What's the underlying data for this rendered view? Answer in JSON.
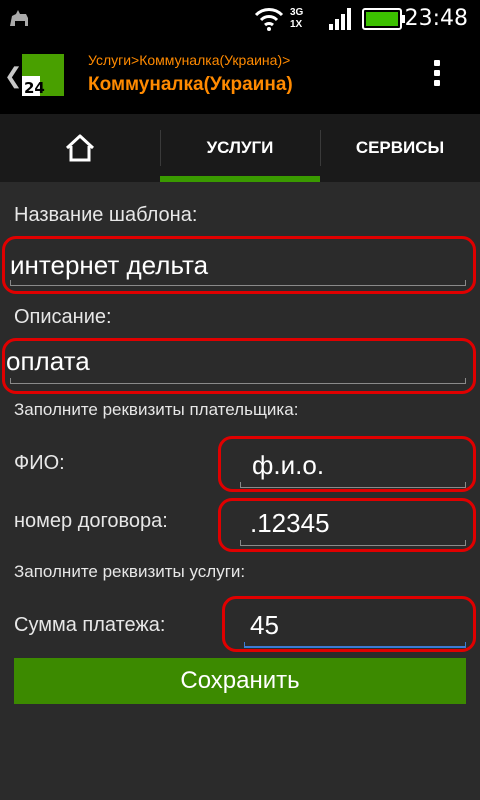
{
  "status": {
    "time": "23:48",
    "network": "3G"
  },
  "header": {
    "breadcrumb": "Услуги>Коммуналка(Украина)>",
    "title": "Коммуналка(Украина)"
  },
  "tabs": [
    {
      "label": ""
    },
    {
      "label": "УСЛУГИ"
    },
    {
      "label": "СЕРВИСЫ"
    }
  ],
  "form": {
    "template_name_label": "Название шаблона:",
    "template_name_value": "интернет дельта",
    "description_label": "Описание:",
    "description_value": "оплата",
    "payer_section": "Заполните реквизиты плательщика:",
    "fio_label": "ФИО:",
    "fio_value": "ф.и.о.",
    "contract_label": "номер договора:",
    "contract_value": ".12345",
    "service_section": "Заполните реквизиты услуги:",
    "amount_label": "Сумма платежа:",
    "amount_value": "45",
    "save_label": "Сохранить"
  },
  "colors": {
    "accent": "#ff8a00",
    "brand_green": "#3c8a00",
    "highlight": "#e00000"
  }
}
